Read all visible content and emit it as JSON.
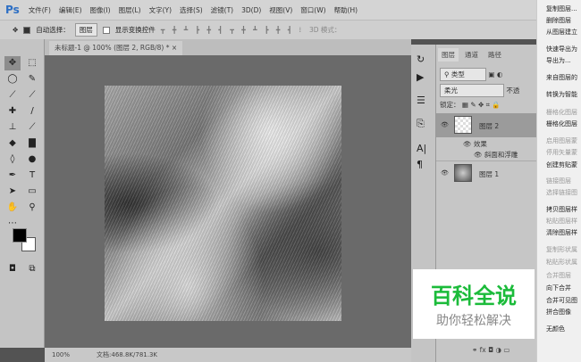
{
  "app": {
    "logo": "Ps"
  },
  "menu": [
    "文件(F)",
    "编辑(E)",
    "图像(I)",
    "图层(L)",
    "文字(Y)",
    "选择(S)",
    "滤镜(T)",
    "3D(D)",
    "视图(V)",
    "窗口(W)",
    "帮助(H)"
  ],
  "options": {
    "auto_select_label": "自动选择：",
    "auto_select_value": "图层",
    "show_transform_label": "显示变换控件",
    "mode_3d": "3D 模式："
  },
  "document": {
    "tab_title": "未标题-1 @ 100% (图层 2, RGB/8) *",
    "close": "×"
  },
  "status": {
    "zoom": "100%",
    "doc_size": "文档:468.8K/781.3K"
  },
  "layers_panel": {
    "tabs": [
      "图层",
      "通道",
      "路径"
    ],
    "filter": "类型",
    "blend_mode": "柔光",
    "opacity_label": "不透",
    "lock_label": "锁定：",
    "layers": [
      {
        "name": "图层 2",
        "selected": true
      },
      {
        "name": "图层 1",
        "selected": false
      }
    ],
    "effects_label": "效果",
    "effect": "斜面和浮雕"
  },
  "context_menu": [
    {
      "label": "复制图层...",
      "enabled": true
    },
    {
      "label": "删除图层",
      "enabled": true
    },
    {
      "label": "从图层建立",
      "enabled": true
    },
    {
      "label": "快速导出为",
      "enabled": true
    },
    {
      "label": "导出为...",
      "enabled": true
    },
    {
      "label": "来自图层的",
      "enabled": true
    },
    {
      "label": "转换为智能",
      "enabled": true
    },
    {
      "label": "栅格化图层",
      "enabled": false
    },
    {
      "label": "栅格化图层",
      "enabled": true
    },
    {
      "label": "启用图层蒙",
      "enabled": false
    },
    {
      "label": "停用矢量蒙",
      "enabled": false
    },
    {
      "label": "创建剪贴蒙",
      "enabled": true
    },
    {
      "label": "链接图层",
      "enabled": false
    },
    {
      "label": "选择链接图",
      "enabled": false
    },
    {
      "label": "拷贝图层样",
      "enabled": true
    },
    {
      "label": "粘贴图层样",
      "enabled": false
    },
    {
      "label": "清除图层样",
      "enabled": true
    },
    {
      "label": "复制形状属",
      "enabled": false
    },
    {
      "label": "粘贴形状属",
      "enabled": false
    },
    {
      "label": "合并图层",
      "enabled": false
    },
    {
      "label": "向下合并",
      "enabled": true
    },
    {
      "label": "合并可见图",
      "enabled": true
    },
    {
      "label": "拼合图像",
      "enabled": true
    },
    {
      "label": "无颜色",
      "enabled": true
    }
  ],
  "watermark": {
    "title": "百科全说",
    "subtitle": "助你轻松解决"
  }
}
